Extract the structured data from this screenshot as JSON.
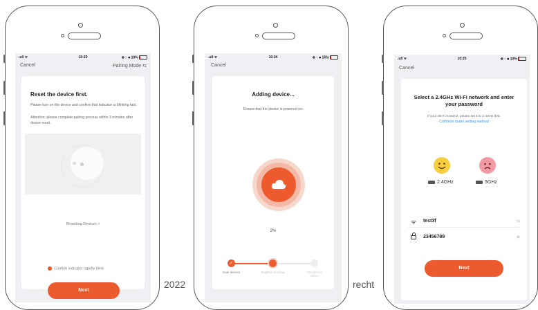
{
  "colors": {
    "accent": "#ec5a2e",
    "link": "#3d8fe0",
    "bg": "#eef0f3"
  },
  "phone1": {
    "status": {
      "signal": ".ull ᯤ",
      "time": "10:23",
      "right": "⊕ ↑ ■ 10%"
    },
    "cancel": "Cancel",
    "pairing_mode": "Pairing Mode ⇆",
    "title": "Reset the device first.",
    "desc": "Please turn on the device and confirm that indicator is blinking fast.",
    "attention": "Attention: please complete pairing process within 3 minutes after device reset.",
    "resetting_link": "Resetting Devices >",
    "confirm_label": "Confirm indicator rapidly blink",
    "next_label": "Next"
  },
  "phone2": {
    "status": {
      "signal": ".ull ᯤ",
      "time": "10:24",
      "right": "⊕ ↑ ■ 15%"
    },
    "cancel": "Cancel",
    "title": "Adding device...",
    "subtitle": "Ensure that the device is powered on.",
    "progress_text": "2%",
    "progress": 0.02,
    "steps": [
      {
        "label": "Scan devices.",
        "state": "done"
      },
      {
        "label": "Register on Cloud.",
        "state": "active"
      },
      {
        "label": "Initialize the device.",
        "state": "pending"
      }
    ]
  },
  "phone3": {
    "status": {
      "signal": ".ull ᯤ",
      "time": "10:25",
      "right": "⊕ ↑ ■ 10%"
    },
    "cancel": "Cancel",
    "title": "Select a 2.4GHz Wi-Fi network and enter your password",
    "hint": "If your Wi-Fi is 5GHz, please set it to 2.4GHz first.",
    "router_link": "Common router setting method",
    "band_ok": "2.4GHz",
    "band_bad": "5GHz",
    "wifi_name": "test3f",
    "wifi_switch": "⇆",
    "password": "23456789",
    "eye": "◉",
    "next_label": "Next"
  },
  "footer": {
    "year_text": "2022",
    "right_text": "recht"
  }
}
